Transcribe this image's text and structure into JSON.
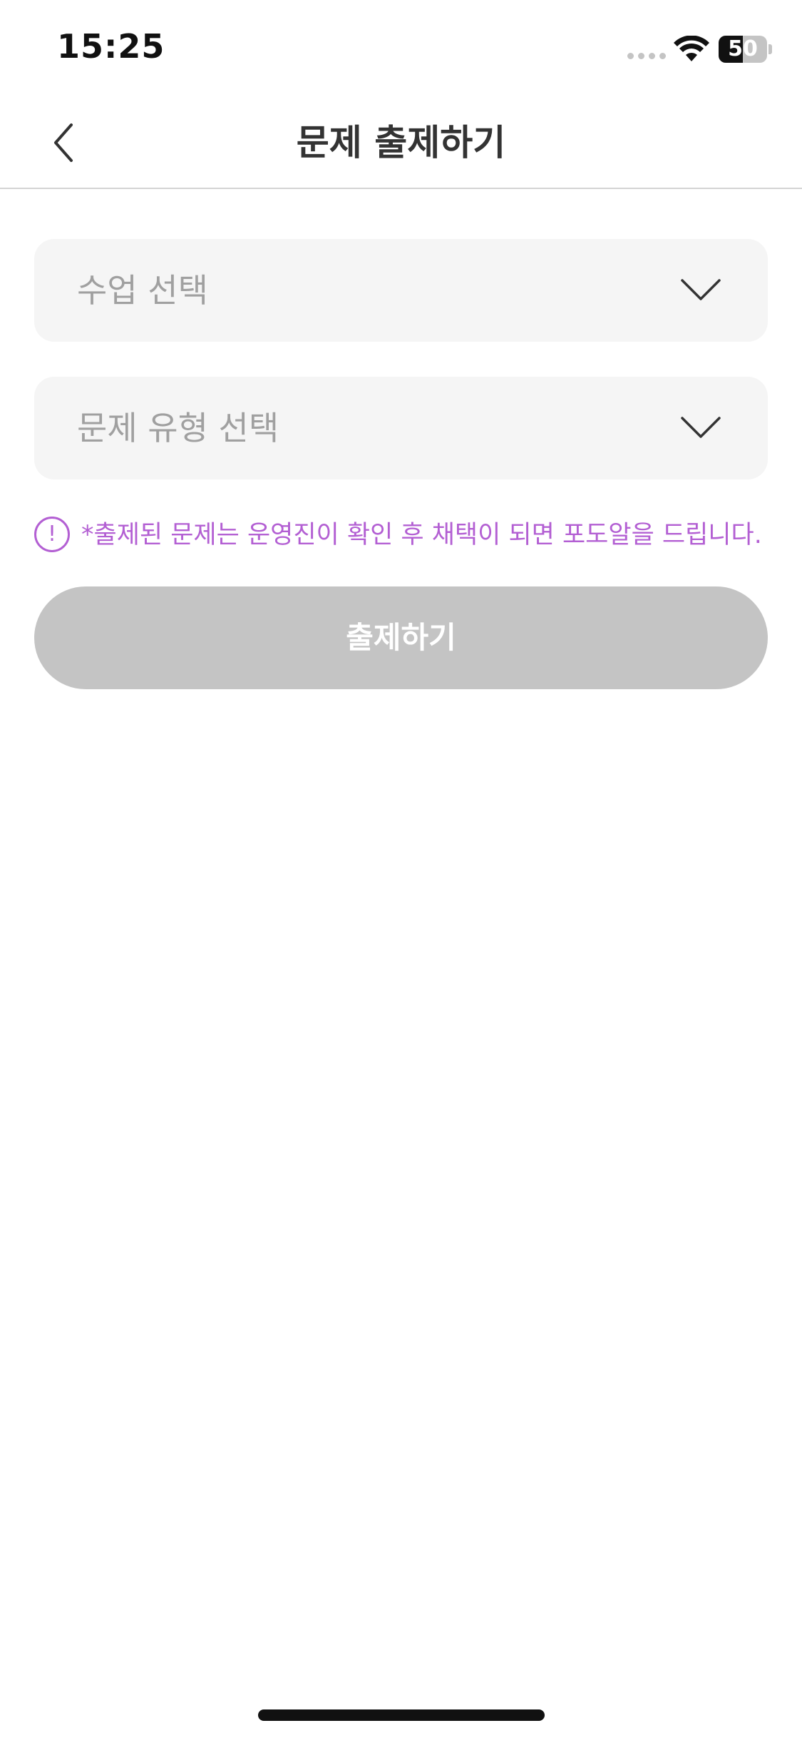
{
  "status_bar": {
    "time": "15:25",
    "battery_level": "50",
    "battery_fraction": 0.5
  },
  "nav": {
    "title": "문제 출제하기",
    "back_icon": "chevron-left-icon"
  },
  "form": {
    "class_select": {
      "placeholder": "수업 선택",
      "icon": "chevron-down-icon"
    },
    "type_select": {
      "placeholder": "문제 유형 선택",
      "icon": "chevron-down-icon"
    },
    "notice": {
      "icon": "alert-circle-icon",
      "icon_glyph": "!",
      "text": "*출제된 문제는 운영진이 확인 후 채택이 되면 포도알을 드립니다."
    },
    "submit_label": "출제하기"
  },
  "colors": {
    "accent": "#b35fd3",
    "field_bg": "#f5f5f5",
    "button_disabled": "#c4c4c4",
    "placeholder": "#a0a0a0",
    "title": "#333333"
  }
}
